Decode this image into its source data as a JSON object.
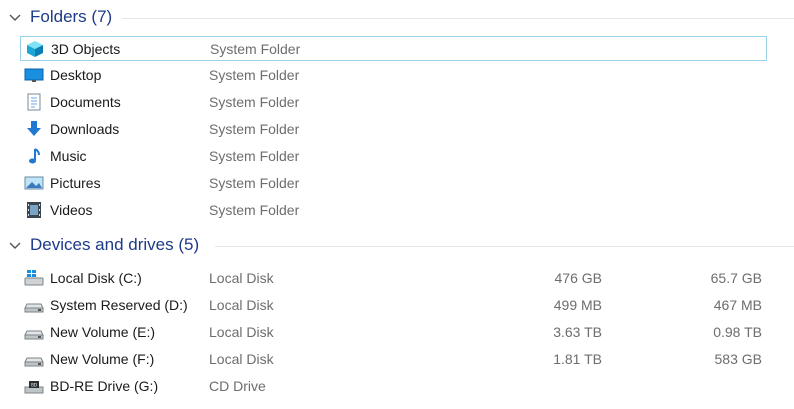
{
  "groups": {
    "folders": {
      "title": "Folders (7)",
      "items": [
        {
          "name": "3D Objects",
          "type": "System Folder",
          "icon": "3d-objects-icon"
        },
        {
          "name": "Desktop",
          "type": "System Folder",
          "icon": "desktop-icon"
        },
        {
          "name": "Documents",
          "type": "System Folder",
          "icon": "documents-icon"
        },
        {
          "name": "Downloads",
          "type": "System Folder",
          "icon": "downloads-icon"
        },
        {
          "name": "Music",
          "type": "System Folder",
          "icon": "music-icon"
        },
        {
          "name": "Pictures",
          "type": "System Folder",
          "icon": "pictures-icon"
        },
        {
          "name": "Videos",
          "type": "System Folder",
          "icon": "videos-icon"
        }
      ]
    },
    "drives": {
      "title": "Devices and drives (5)",
      "items": [
        {
          "name": "Local Disk (C:)",
          "type": "Local Disk",
          "total": "476 GB",
          "free": "65.7 GB",
          "icon": "windows-drive-icon"
        },
        {
          "name": "System Reserved (D:)",
          "type": "Local Disk",
          "total": "499 MB",
          "free": "467 MB",
          "icon": "hard-drive-icon"
        },
        {
          "name": "New Volume (E:)",
          "type": "Local Disk",
          "total": "3.63 TB",
          "free": "0.98 TB",
          "icon": "hard-drive-icon"
        },
        {
          "name": "New Volume (F:)",
          "type": "Local Disk",
          "total": "1.81 TB",
          "free": "583 GB",
          "icon": "hard-drive-icon"
        },
        {
          "name": "BD-RE Drive (G:)",
          "type": "CD Drive",
          "total": "",
          "free": "",
          "icon": "optical-drive-icon"
        }
      ]
    }
  },
  "colors": {
    "group_title": "#1e3a8a",
    "selection_border": "#99d1e8",
    "secondary_text": "#6d6d6d"
  }
}
